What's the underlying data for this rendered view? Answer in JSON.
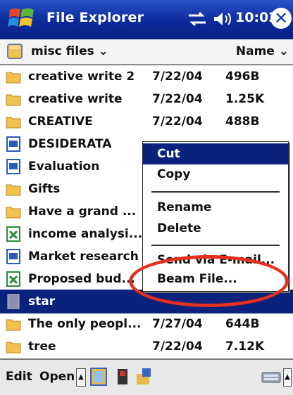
{
  "title_bar": {
    "app_title": "File Explorer",
    "clock": "10:02",
    "close_glyph": "✕",
    "icons": [
      "start-flag-icon",
      "connectivity-icon",
      "volume-icon",
      "close-icon"
    ]
  },
  "location_bar": {
    "folder": "misc files ⌄",
    "sort_by": "Name ⌄"
  },
  "files": [
    {
      "name": "creative write 2",
      "date": "7/22/04",
      "size": "496B",
      "icon": "folder-icon"
    },
    {
      "name": "creative write",
      "date": "7/22/04",
      "size": "1.25K",
      "icon": "folder-icon"
    },
    {
      "name": "CREATIVE",
      "date": "7/22/04",
      "size": "488B",
      "icon": "folder-icon"
    },
    {
      "name": "DESIDERATA",
      "date": "",
      "size": "",
      "icon": "word-doc-icon"
    },
    {
      "name": "Evaluation",
      "date": "",
      "size": "",
      "icon": "word-doc-icon"
    },
    {
      "name": "Gifts",
      "date": "",
      "size": "",
      "icon": "folder-icon"
    },
    {
      "name": "Have a grand ...",
      "date": "",
      "size": "",
      "icon": "folder-icon"
    },
    {
      "name": "income analysi...",
      "date": "",
      "size": "",
      "icon": "excel-sheet-icon"
    },
    {
      "name": "Market research",
      "date": "",
      "size": "",
      "icon": "word-doc-icon"
    },
    {
      "name": "Proposed bud...",
      "date": "",
      "size": "",
      "icon": "excel-sheet-icon"
    },
    {
      "name": "star",
      "date": "",
      "size": "",
      "icon": "image-file-icon",
      "selected": true
    },
    {
      "name": "The only peopl...",
      "date": "7/27/04",
      "size": "644B",
      "icon": "folder-icon"
    },
    {
      "name": "tree",
      "date": "7/22/04",
      "size": "7.12K",
      "icon": "folder-icon"
    }
  ],
  "context_menu": {
    "cut": "Cut",
    "copy": "Copy",
    "rename": "Rename",
    "delete": "Delete",
    "send_via_email": "Send via E-mail...",
    "beam_file": "Beam File..."
  },
  "bottom_bar": {
    "edit": "Edit",
    "open": "Open",
    "up_glyph": "▲",
    "icons": [
      "folder-view-icon",
      "storage-card-icon",
      "network-share-icon",
      "keyboard-icon"
    ]
  },
  "colors": {
    "title_bar": "#0b2a99",
    "selection": "#0a227c",
    "highlight_ring": "#e3301f",
    "folder": "#f2c14e"
  }
}
